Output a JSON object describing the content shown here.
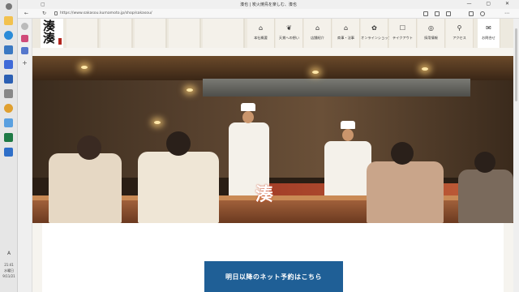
{
  "browser": {
    "title": "湊也 | 炭火焼鳥を楽しむ、湊也",
    "url": "https://www.sakasou.kumamoto.jp/shop/sakasou/",
    "window_controls": "— ▢ ✕"
  },
  "taskbar": {
    "time": "21:41",
    "day": "水曜日",
    "date": "9/11/21",
    "lang": "A"
  },
  "site": {
    "logo_text": "湊 湊",
    "nav": [
      {
        "label": "本社概要",
        "icon": "map-icon",
        "glyph": "⌂"
      },
      {
        "label": "天賞への想い",
        "icon": "fish-icon",
        "glyph": "❦"
      },
      {
        "label": "店舗紹介",
        "icon": "shop-icon",
        "glyph": "⌂"
      },
      {
        "label": "商事・法事",
        "icon": "house-icon",
        "glyph": "⌂"
      },
      {
        "label": "オンラインショップ",
        "icon": "flower-icon",
        "glyph": "✿"
      },
      {
        "label": "テイクアウト",
        "icon": "bag-icon",
        "glyph": "☐"
      },
      {
        "label": "採用情報",
        "icon": "search-icon",
        "glyph": "◎"
      },
      {
        "label": "アクセス",
        "icon": "pin-icon",
        "glyph": "⚲"
      },
      {
        "label": "お問合せ",
        "icon": "mail-icon",
        "glyph": "✉"
      }
    ],
    "hero_sign": "湊",
    "cta_label": "明日以降のネット予約はこちら"
  },
  "colors": {
    "cta": "#1f5f96",
    "header_bg": "#ede9df"
  }
}
